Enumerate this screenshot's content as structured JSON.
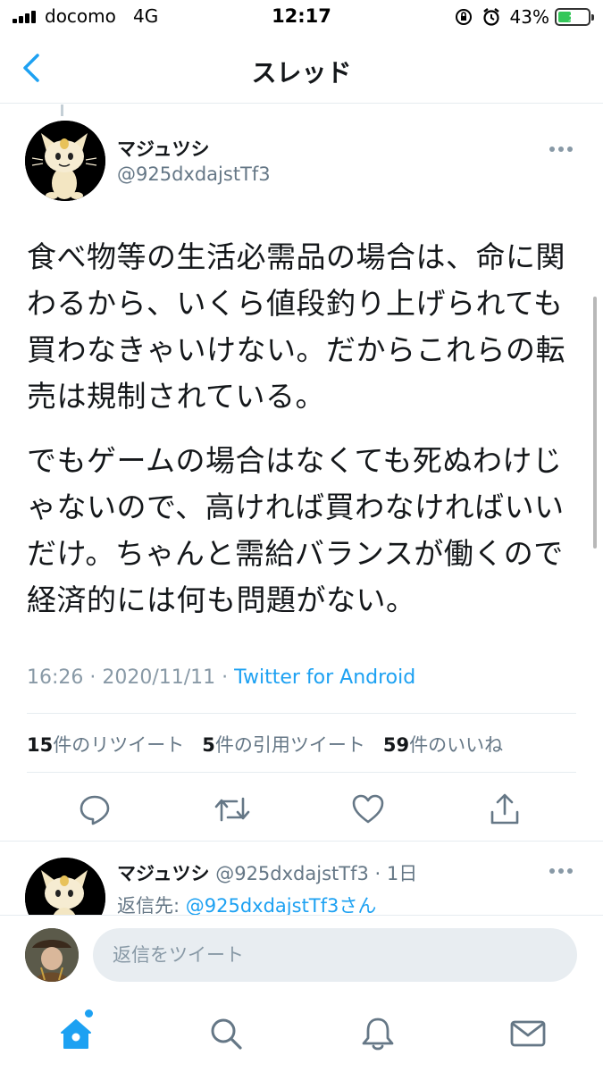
{
  "status_bar": {
    "carrier": "docomo",
    "network": "4G",
    "time": "12:17",
    "battery_percent": "43%",
    "battery_level": 0.43,
    "battery_color": "#34c759",
    "icons": [
      "signal-icon",
      "orientation-lock-icon",
      "alarm-icon",
      "battery-charging-icon"
    ]
  },
  "header": {
    "title": "スレッド",
    "back_icon": "chevron-left-icon"
  },
  "tweet": {
    "display_name": "マジュツシ",
    "handle": "@925dxdajstTf3",
    "paragraphs": [
      "食べ物等の生活必需品の場合は、命に関わるから、いくら値段釣り上げられても買わなきゃいけない。だからこれらの転売は規制されている。",
      "でもゲームの場合はなくても死ぬわけじゃないので、高ければ買わなければいいだけ。ちゃんと需給バランスが働くので経済的には何も問題がない。"
    ],
    "timestamp": "16:26 · 2020/11/11 · ",
    "source": "Twitter for Android",
    "stats": {
      "retweets_count": "15",
      "retweets_label": "件のリツイート",
      "quotes_count": "5",
      "quotes_label": "件の引用ツイート",
      "likes_count": "59",
      "likes_label": "件のいいね"
    },
    "actions": [
      "reply-icon",
      "retweet-icon",
      "like-icon",
      "share-icon"
    ]
  },
  "reply_tweet": {
    "display_name": "マジュツシ",
    "handle_time": " @925dxdajstTf3 · 1日",
    "reply_to_prefix": "返信先: ",
    "reply_to_target": "@925dxdajstTf3さん"
  },
  "composer": {
    "placeholder": "返信をツイート"
  },
  "tab_bar": {
    "tabs": [
      "home-icon",
      "search-icon",
      "notifications-icon",
      "messages-icon"
    ],
    "active": "home-icon"
  },
  "colors": {
    "accent": "#1da1f2",
    "secondary_text": "#657786",
    "divider": "#e6ecf0"
  }
}
